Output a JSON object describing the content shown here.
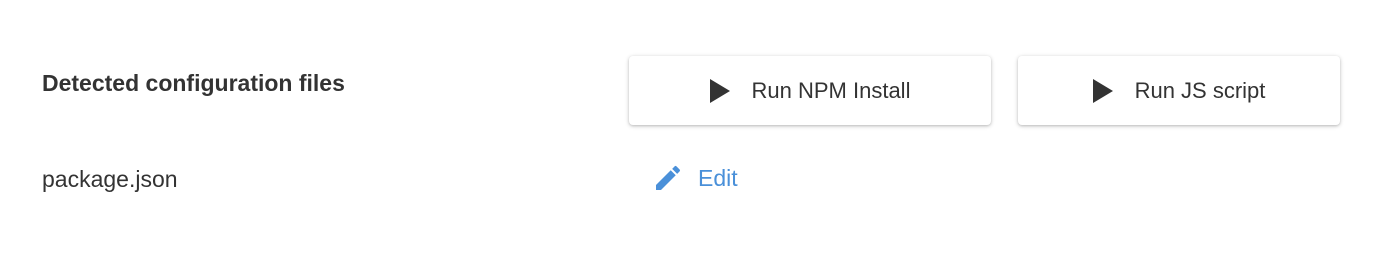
{
  "section": {
    "title": "Detected configuration files"
  },
  "actions": {
    "npm_install_label": "Run NPM Install",
    "run_js_label": "Run JS script"
  },
  "files": [
    {
      "name": "package.json",
      "edit_label": "Edit"
    }
  ],
  "icons": {
    "run": "play-icon",
    "edit": "pencil-icon"
  },
  "colors": {
    "link": "#4a90d9",
    "text": "#333333"
  }
}
